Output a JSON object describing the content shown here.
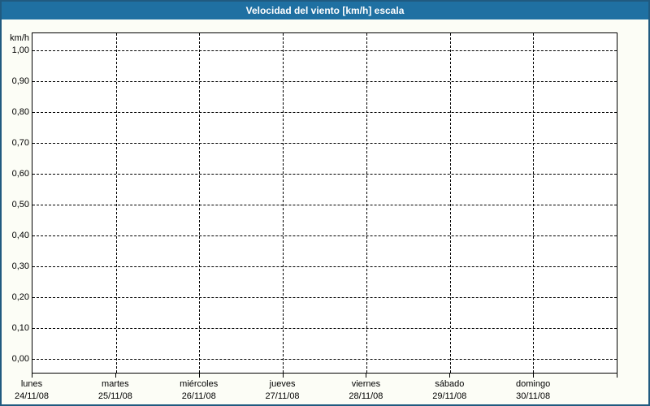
{
  "window": {
    "title": "Velocidad del viento [km/h] escala"
  },
  "colors": {
    "title_bar_bg": "#1F70A2",
    "title_text": "#FFFFFF",
    "frame_border": "#205A80",
    "page_bg": "#FCFDF6",
    "plot_bg": "#FFFFFF",
    "plot_border": "#000000",
    "gridline": "#000000",
    "label_text": "#000000"
  },
  "chart_data": {
    "type": "line",
    "title": "Velocidad del viento [km/h] escala",
    "ylabel": "km/h",
    "y_axis": {
      "unit": "km/h",
      "min": 0.0,
      "max": 1.0,
      "step": 0.1,
      "tick_labels": [
        "0,00",
        "0,10",
        "0,20",
        "0,30",
        "0,40",
        "0,50",
        "0,60",
        "0,70",
        "0,80",
        "0,90",
        "1,00"
      ]
    },
    "x_axis": {
      "categories": [
        {
          "day": "lunes",
          "date": "24/11/08"
        },
        {
          "day": "martes",
          "date": "25/11/08"
        },
        {
          "day": "miércoles",
          "date": "26/11/08"
        },
        {
          "day": "jueves",
          "date": "27/11/08"
        },
        {
          "day": "viernes",
          "date": "28/11/08"
        },
        {
          "day": "sábado",
          "date": "29/11/08"
        },
        {
          "day": "domingo",
          "date": "30/11/08"
        }
      ]
    },
    "series": [],
    "grid": "dashed",
    "legend": "none"
  }
}
